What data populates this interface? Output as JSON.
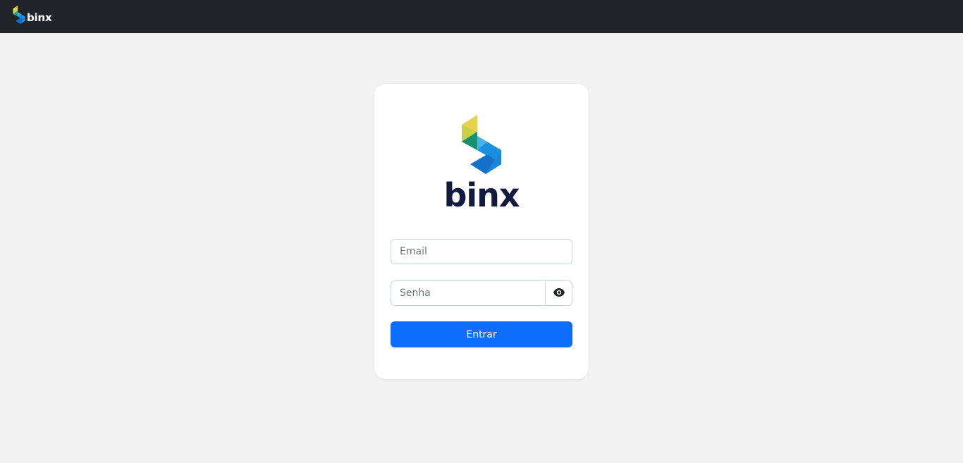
{
  "navbar": {
    "brand_name": "binx",
    "brand_icon": "binx-logo-icon",
    "background": "#212529"
  },
  "login": {
    "logo_text": "binx",
    "logo_icon": "binx-logo-icon",
    "email_placeholder": "Email",
    "email_value": "",
    "password_placeholder": "Senha",
    "password_value": "",
    "toggle_icon": "eye-icon",
    "submit_label": "Entrar"
  },
  "colors": {
    "page_background": "#f2f2f2",
    "primary": "#0d6efd",
    "logo_text": "#121a3f",
    "logo_yellow": "#e6d24a",
    "logo_green": "#1ea385",
    "logo_blue": "#1a8fe0"
  }
}
